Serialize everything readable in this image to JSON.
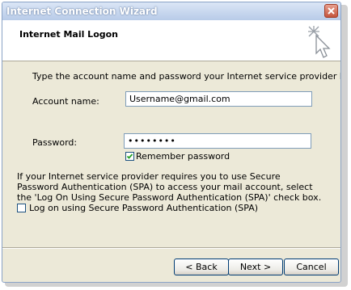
{
  "window": {
    "title": "Internet Connection Wizard"
  },
  "header": {
    "title": "Internet Mail Logon",
    "icon": "wizard-sparkle-icon"
  },
  "instructions": "Type the account name and password your Internet service provider has given you.",
  "account": {
    "label": "Account name:",
    "value": "Username@gmail.com"
  },
  "password": {
    "label": "Password:",
    "masked_value": "••••••••"
  },
  "remember": {
    "label": "Remember password",
    "checked": true
  },
  "spa": {
    "description": "If your Internet service provider requires you to use Secure Password Authentication (SPA) to access your mail account, select the 'Log On Using Secure Password Authentication (SPA)' check box.",
    "checkbox_label": "Log on using Secure Password Authentication (SPA)",
    "checked": false
  },
  "buttons": {
    "back": "< Back",
    "next": "Next >",
    "cancel": "Cancel"
  },
  "colors": {
    "title_bar": "#b8cbe8",
    "dialog_bg": "#ece9d8",
    "close_button": "#c4553d"
  }
}
